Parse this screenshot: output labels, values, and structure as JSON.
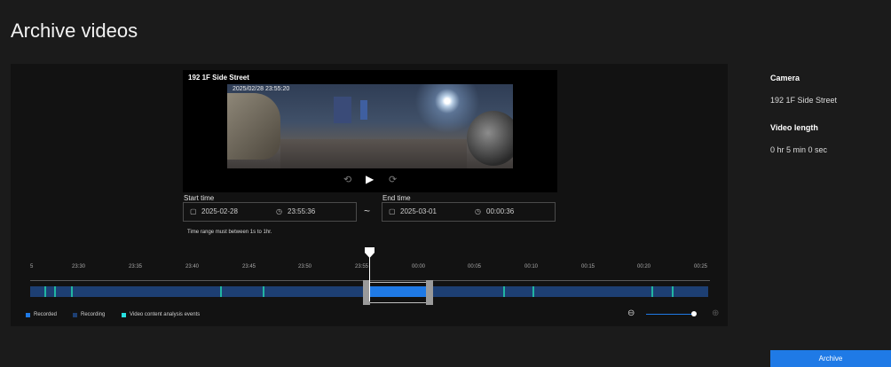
{
  "page": {
    "title": "Archive videos"
  },
  "video": {
    "camera_name": "192 1F Side Street",
    "timestamp": "2025/02/28 23:55:20",
    "controls": {
      "rewind_icon": "rewind-15-icon",
      "play_icon": "play-icon",
      "forward_icon": "forward-15-icon",
      "rewind_glyph": "⟲",
      "play_glyph": "▶",
      "forward_glyph": "⟳"
    }
  },
  "range": {
    "start_label": "Start time",
    "start_date": "2025-02-28",
    "start_time": "23:55:36",
    "end_label": "End time",
    "end_date": "2025-03-01",
    "end_time": "00:00:36",
    "separator": "~",
    "hint": "Time range must between 1s to 1hr.",
    "calendar_icon": "▢",
    "clock_icon": "◷"
  },
  "timeline": {
    "ticks": [
      "5",
      "23:30",
      "23:35",
      "23:40",
      "23:45",
      "23:50",
      "23:55",
      "00:00",
      "00:05",
      "00:10",
      "00:15",
      "00:20",
      "00:25"
    ],
    "legend": [
      {
        "label": "Recorded",
        "color": "#1f7ae6"
      },
      {
        "label": "Recording",
        "color": "#1d3f73"
      },
      {
        "label": "Video content analysis events",
        "color": "#27e0e0"
      }
    ],
    "zoom_out_glyph": "⊖",
    "zoom_in_glyph": "⊕"
  },
  "sidebar": {
    "camera_label": "Camera",
    "camera_value": "192 1F Side Street",
    "length_label": "Video length",
    "length_value": "0 hr 5 min 0 sec"
  },
  "actions": {
    "archive_label": "Archive"
  },
  "colors": {
    "accent": "#1f7ae6",
    "background": "#1b1b1b",
    "panel": "#121212",
    "event": "#21b5a1"
  }
}
